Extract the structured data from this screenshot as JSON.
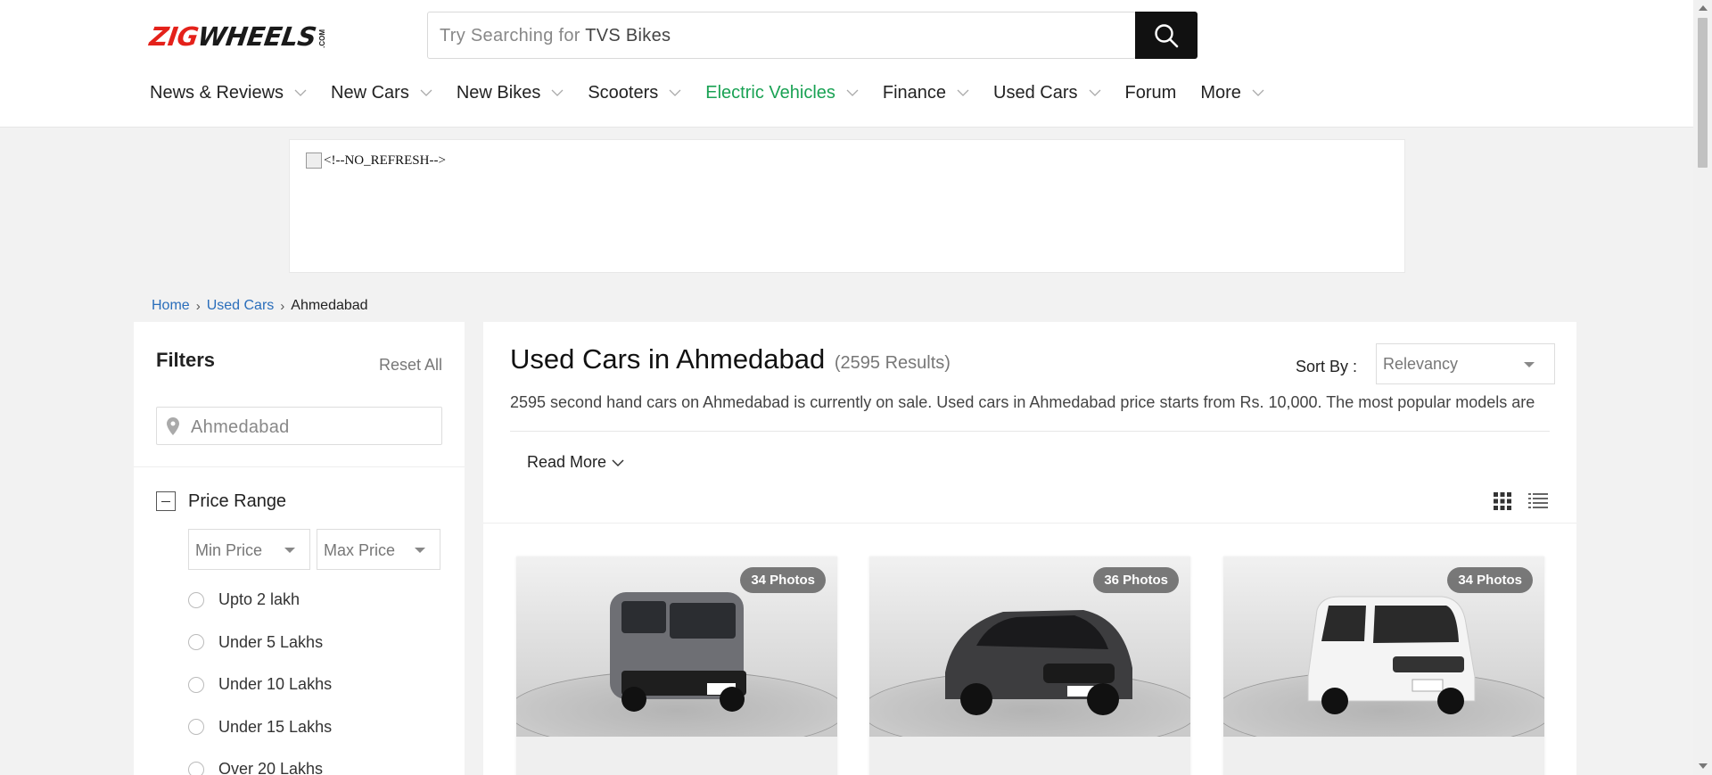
{
  "header": {
    "logo": {
      "part1": "ZIG",
      "part2": "WHEELS",
      "suffix": ".COM"
    },
    "search": {
      "prefix": "Try Searching for",
      "suggestion": "TVS Bikes"
    },
    "nav": [
      {
        "label": "News & Reviews",
        "chevron": true
      },
      {
        "label": "New Cars",
        "chevron": true
      },
      {
        "label": "New Bikes",
        "chevron": true
      },
      {
        "label": "Scooters",
        "chevron": true
      },
      {
        "label": "Electric Vehicles",
        "chevron": true,
        "color": "#1aa254"
      },
      {
        "label": "Finance",
        "chevron": true
      },
      {
        "label": "Used Cars",
        "chevron": true
      },
      {
        "label": "Forum",
        "chevron": false
      },
      {
        "label": "More",
        "chevron": true
      }
    ]
  },
  "ad": {
    "alt_text": "<!--NO_REFRESH-->"
  },
  "breadcrumb": [
    {
      "label": "Home",
      "link": true
    },
    {
      "label": "Used Cars",
      "link": true
    },
    {
      "label": "Ahmedabad",
      "link": false
    }
  ],
  "filters": {
    "title": "Filters",
    "reset": "Reset All",
    "city": "Ahmedabad",
    "price_range": {
      "title": "Price Range",
      "min": "Min Price",
      "max": "Max Price",
      "options": [
        "Upto 2 lakh",
        "Under 5 Lakhs",
        "Under 10 Lakhs",
        "Under 15 Lakhs",
        "Over 20 Lakhs"
      ]
    }
  },
  "listing": {
    "title": "Used Cars in Ahmedabad",
    "count": "(2595 Results)",
    "sort_label": "Sort By :",
    "sort_value": "Relevancy",
    "description": "2595 second hand cars on Ahmedabad is currently on sale. Used cars in Ahmedabad price starts from Rs. 10,000. The most popular models are",
    "read_more": "Read More",
    "cards": [
      {
        "photos": "34 Photos",
        "car": "van",
        "color": "#6e6f74"
      },
      {
        "photos": "36 Photos",
        "car": "hatch",
        "color": "#3d3d3f"
      },
      {
        "photos": "34 Photos",
        "car": "wagon",
        "color": "#f4f4f4"
      }
    ]
  },
  "colors": {
    "brand_red": "#e4211a",
    "accent_green": "#1aa254",
    "link_blue": "#2a6ebb"
  }
}
